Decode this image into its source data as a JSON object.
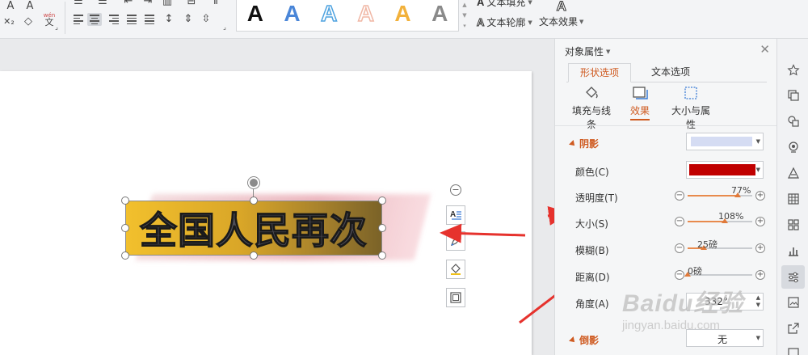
{
  "ribbon": {
    "gallery_letter": "A",
    "gallery_colors": [
      "#111111",
      "#4a86d8",
      "#4fa3e0",
      "#f0b7a5",
      "#f2b13b",
      "#8a8a8a"
    ],
    "text_fill_label": "文本填充",
    "text_outline_label": "文本轮廓",
    "text_effect_label": "文本效果",
    "phonetic_label": "wén"
  },
  "document": {
    "wordart_text": "全国人民再次"
  },
  "panel": {
    "title": "对象属性",
    "tab_shape": "形状选项",
    "tab_text": "文本选项",
    "sub_fill_line": "填充与线条",
    "sub_effects": "效果",
    "sub_size_props": "大小与属性",
    "shadow_section": "阴影",
    "color_label": "颜色(C)",
    "transparency_label": "透明度(T)",
    "transparency_value": "77%",
    "transparency_fraction": 0.77,
    "size_label": "大小(S)",
    "size_value": "108%",
    "size_fraction": 0.58,
    "blur_label": "模糊(B)",
    "blur_value": "25磅",
    "blur_fraction": 0.25,
    "distance_label": "距离(D)",
    "distance_value": "0磅",
    "distance_fraction": 0.0,
    "angle_label": "角度(A)",
    "angle_value": "332°",
    "reflection_section": "倒影",
    "reflection_value": "无",
    "shadow_color": "#c00000",
    "accent": "#cf5a20"
  },
  "watermark": {
    "brand": "Baidu经验",
    "url": "jingyan.baidu.com"
  }
}
